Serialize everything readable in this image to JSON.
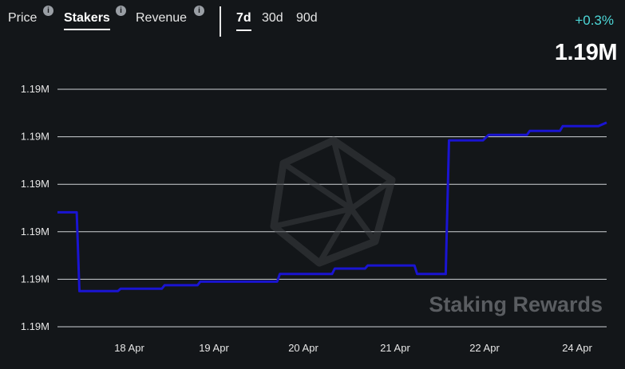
{
  "tabs": [
    {
      "label": "Price",
      "active": false
    },
    {
      "label": "Stakers",
      "active": true
    },
    {
      "label": "Revenue",
      "active": false
    }
  ],
  "info_icon_glyph": "i",
  "periods": [
    {
      "label": "7d",
      "active": true
    },
    {
      "label": "30d",
      "active": false
    },
    {
      "label": "90d",
      "active": false
    }
  ],
  "summary": {
    "change": "+0.3%",
    "value": "1.19M"
  },
  "watermark": "Staking Rewards",
  "colors": {
    "background": "#131619",
    "line": "#1a14d2",
    "grid": "#cfd2d6",
    "accent_change": "#4dd8d8"
  },
  "chart_data": {
    "type": "line",
    "y_tick_labels": [
      "1.19M",
      "1.19M",
      "1.19M",
      "1.19M",
      "1.19M",
      "1.19M"
    ],
    "x_tick_labels": [
      "18 Apr",
      "19 Apr",
      "20 Apr",
      "21 Apr",
      "22 Apr",
      "24 Apr"
    ],
    "grid": true,
    "series": [
      {
        "values": [
          [
            0.0,
            0.482
          ],
          [
            0.035,
            0.482
          ],
          [
            0.04,
            0.15
          ],
          [
            0.11,
            0.15
          ],
          [
            0.115,
            0.16
          ],
          [
            0.19,
            0.16
          ],
          [
            0.195,
            0.175
          ],
          [
            0.255,
            0.175
          ],
          [
            0.26,
            0.19
          ],
          [
            0.4,
            0.19
          ],
          [
            0.405,
            0.222
          ],
          [
            0.5,
            0.222
          ],
          [
            0.505,
            0.245
          ],
          [
            0.56,
            0.245
          ],
          [
            0.565,
            0.258
          ],
          [
            0.65,
            0.258
          ],
          [
            0.655,
            0.222
          ],
          [
            0.707,
            0.222
          ],
          [
            0.713,
            0.785
          ],
          [
            0.775,
            0.785
          ],
          [
            0.785,
            0.808
          ],
          [
            0.855,
            0.808
          ],
          [
            0.86,
            0.825
          ],
          [
            0.915,
            0.825
          ],
          [
            0.92,
            0.845
          ],
          [
            0.985,
            0.845
          ],
          [
            1.0,
            0.86
          ]
        ]
      }
    ]
  }
}
